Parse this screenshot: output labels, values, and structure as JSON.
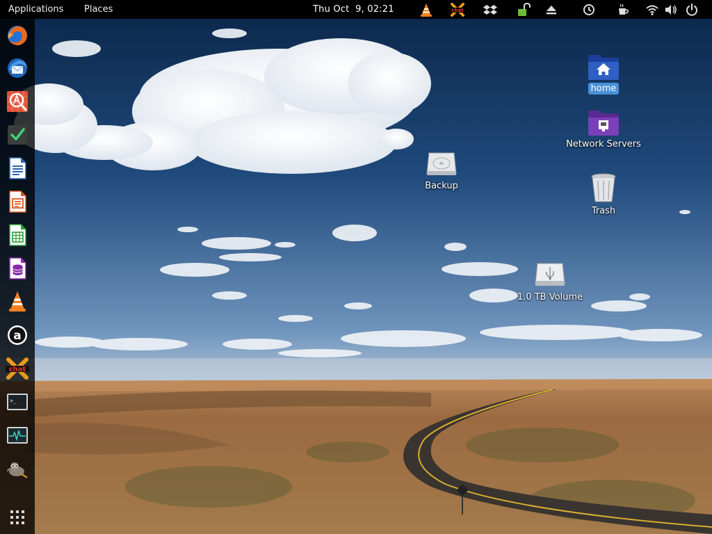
{
  "topbar": {
    "applications_label": "Applications",
    "places_label": "Places",
    "clock": "Thu Oct  9, 02:21",
    "tray_icons": [
      "vlc-icon",
      "xchat-icon",
      "dropbox-icon",
      "unlock-icon",
      "eject-icon",
      "clock-icon",
      "weather-icon",
      "wifi-icon",
      "volume-icon",
      "power-icon"
    ],
    "xchat_text": "chat"
  },
  "dock": {
    "items": [
      "firefox-icon",
      "thunderbird-icon",
      "software-center-icon",
      "task-manager-icon",
      "libreoffice-writer-icon",
      "libreoffice-impress-icon",
      "libreoffice-calc-icon",
      "libreoffice-base-icon",
      "vlc-icon",
      "amarok-icon",
      "xchat-icon",
      "terminal-icon",
      "system-monitor-icon",
      "gimp-icon",
      "app-grid-icon"
    ],
    "terminal_prompt": ">_",
    "amarok_letter": "a",
    "xchat_text": "chat"
  },
  "desktop": {
    "icons": [
      {
        "label": "home",
        "icon": "home-folder-icon",
        "selected": true
      },
      {
        "label": "Network Servers",
        "icon": "network-folder-icon",
        "selected": false
      },
      {
        "label": "Backup",
        "icon": "hard-drive-icon",
        "selected": false
      },
      {
        "label": "Trash",
        "icon": "trash-icon",
        "selected": false
      },
      {
        "label": "1.0 TB Volume",
        "icon": "usb-drive-icon",
        "selected": false
      }
    ]
  },
  "colors": {
    "topbar_bg": "#000000",
    "dock_bg": "#141414",
    "selection": "#4a90d9",
    "sky_top": "#0c2a4e",
    "sky_bottom": "#5a85b4",
    "desert": "#a2764a",
    "folder_blue": "#2f5fc4",
    "folder_purple": "#7b3fb8"
  }
}
